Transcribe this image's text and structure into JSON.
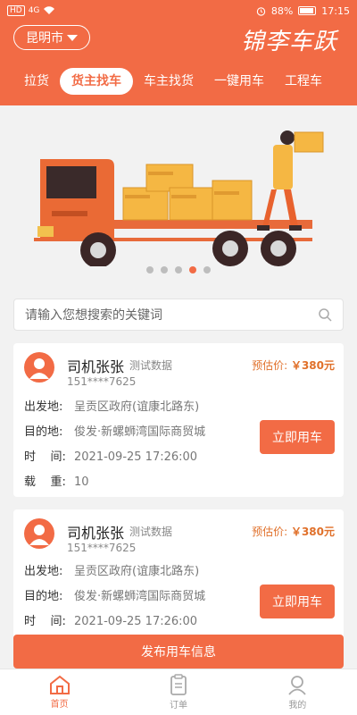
{
  "status_bar": {
    "network": "HD",
    "signal": "4G",
    "battery": "88%",
    "time": "17:15"
  },
  "header": {
    "city": "昆明市",
    "brand": "锦李车跃"
  },
  "tabs": [
    {
      "label": "拉货",
      "active": false
    },
    {
      "label": "货主找车",
      "active": true
    },
    {
      "label": "车主找货",
      "active": false
    },
    {
      "label": "一键用车",
      "active": false
    },
    {
      "label": "工程车",
      "active": false
    }
  ],
  "banner": {
    "slide_count": 5,
    "active_slide": 3
  },
  "search": {
    "placeholder": "请输入您想搜索的关键词"
  },
  "cards": [
    {
      "driver": "司机张张",
      "tag": "测试数据",
      "phone": "151****7625",
      "price_label": "预估价:",
      "price": "￥380元",
      "from_label": "出发地:",
      "from": "呈贡区政府(谊康北路东)",
      "to_label": "目的地:",
      "to": "俊发·新螺蛳湾国际商贸城",
      "time_label": "时    间:",
      "time": "2021-09-25 17:26:00",
      "load_label": "载    重:",
      "load": "10",
      "button": "立即用车"
    },
    {
      "driver": "司机张张",
      "tag": "测试数据",
      "phone": "151****7625",
      "price_label": "预估价:",
      "price": "￥380元",
      "from_label": "出发地:",
      "from": "呈贡区政府(谊康北路东)",
      "to_label": "目的地:",
      "to": "俊发·新螺蛳湾国际商贸城",
      "time_label": "时    间:",
      "time": "2021-09-25 17:26:00",
      "button": "立即用车"
    }
  ],
  "publish_button": "发布用车信息",
  "bottom_nav": [
    {
      "label": "首页",
      "icon": "home-icon",
      "active": true
    },
    {
      "label": "订单",
      "icon": "clipboard-icon",
      "active": false
    },
    {
      "label": "我的",
      "icon": "user-icon",
      "active": false
    }
  ],
  "colors": {
    "accent": "#f26b45",
    "price": "#e0702a"
  }
}
